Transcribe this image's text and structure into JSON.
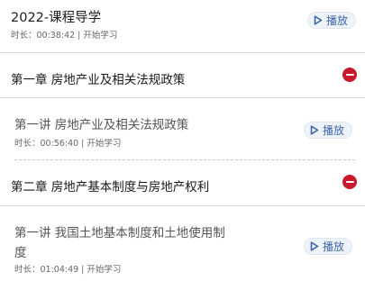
{
  "course": {
    "title": "2022-课程导学",
    "meta": "时长：00:38:42 | 开始学习",
    "play_label": "播放"
  },
  "chapters": [
    {
      "title": "第一章 房地产业及相关法规政策",
      "lessons": [
        {
          "title": "第一讲 房地产业及相关法规政策",
          "meta": "时长：00:56:40 | 开始学习",
          "play_label": "播放"
        }
      ]
    },
    {
      "title": "第二章 房地产基本制度与房地产权利",
      "lessons": [
        {
          "title_line1": "第一讲 我国土地基本制度和土地使用制",
          "title_line2": "度",
          "meta": "时长：01:04:49 | 开始学习",
          "play_label": "播放"
        }
      ]
    }
  ],
  "colors": {
    "accent_blue": "#3f66a9",
    "collapse_red": "#c81a2b",
    "divider": "#d8d8d8"
  },
  "icons": {
    "play": "play-outline-icon",
    "collapse": "minus-circle-icon"
  }
}
